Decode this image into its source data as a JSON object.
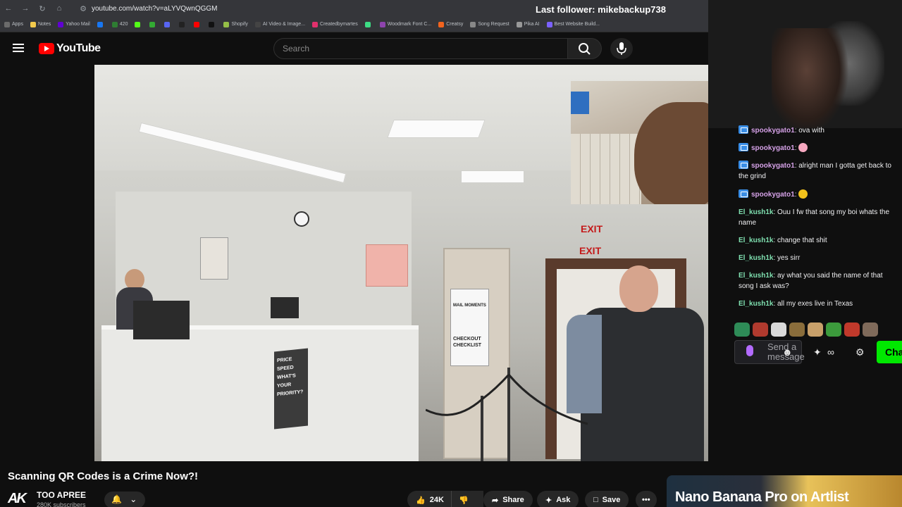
{
  "browser": {
    "url": "youtube.com/watch?v=aLYVQwnQGGM",
    "bookmarks": [
      {
        "label": "Apps",
        "color": "#6b6b6b"
      },
      {
        "label": "Notes",
        "color": "#f2c94c"
      },
      {
        "label": "Yahoo Mail",
        "color": "#6001d2"
      },
      {
        "label": "",
        "color": "#1877f2"
      },
      {
        "label": "420",
        "color": "#2e7d32"
      },
      {
        "label": "",
        "color": "#53fc18"
      },
      {
        "label": "",
        "color": "#33aa33"
      },
      {
        "label": "",
        "color": "#5865f2"
      },
      {
        "label": "",
        "color": "#222222"
      },
      {
        "label": "",
        "color": "#ff0000"
      },
      {
        "label": "",
        "color": "#111111"
      },
      {
        "label": "Shopify",
        "color": "#95bf47"
      },
      {
        "label": "AI Video & Image...",
        "color": "#444444"
      },
      {
        "label": "Createdbymartes",
        "color": "#e1306c"
      },
      {
        "label": "",
        "color": "#3ddc84"
      },
      {
        "label": "Woodmark Font C...",
        "color": "#8e44ad"
      },
      {
        "label": "Creatsy",
        "color": "#f1641e"
      },
      {
        "label": "Song Request",
        "color": "#888888"
      },
      {
        "label": "Pika AI",
        "color": "#999999"
      },
      {
        "label": "Best Website Build...",
        "color": "#7b61ff"
      }
    ]
  },
  "overlay": {
    "last_follower": "Last follower: mikebackup738"
  },
  "youtube": {
    "logo_text": "YouTube",
    "search_placeholder": "Search"
  },
  "video": {
    "exit_sign_1": "EXIT",
    "exit_sign_2": "EXIT",
    "checkout_sign": "CHECKOUT CHECKLIST",
    "mail_sign": "MAIL MOMENTS",
    "price_poster": "PRICE SPEED WHAT'S YOUR PRIORITY?"
  },
  "chat": {
    "messages": [
      {
        "user": "spookygato1",
        "text": "ova with",
        "emoji": null
      },
      {
        "user": "spookygato1",
        "text": "",
        "emoji": "pig-face"
      },
      {
        "user": "spookygato1",
        "text": "alright man I gotta get back to the grind",
        "emoji": null
      },
      {
        "user": "spookygato1",
        "text": "",
        "emoji": "star"
      },
      {
        "user": "El_kush1k",
        "text": "Ouu I fw that song my boi whats the name",
        "emoji": null
      },
      {
        "user": "El_kush1k",
        "text": "change that shit",
        "emoji": null
      },
      {
        "user": "El_kush1k",
        "text": "yes sirr",
        "emoji": null
      },
      {
        "user": "El_kush1k",
        "text": "ay what you said the name of that song I ask was?",
        "emoji": null
      },
      {
        "user": "El_kush1k",
        "text": "all my exes live in Texas",
        "emoji": null
      }
    ],
    "send_placeholder": "Send a message",
    "chat_button": "Cha",
    "accent": "#00e800",
    "emote_colors": [
      "#2e8b57",
      "#b03a2e",
      "#d9d9d9",
      "#8a6d3b",
      "#c8a06a",
      "#3c9a3c",
      "#c0392b",
      "#7f6a5a"
    ]
  },
  "below": {
    "title": "Scanning QR Codes is a Crime Now?!",
    "channel_logo": "AK",
    "channel_name": "TOO APREE",
    "subscribers": "280K subscribers",
    "likes": "24K",
    "share": "Share",
    "ask": "Ask",
    "save": "Save",
    "more": "•••",
    "ad_text": "Nano Banana Pro on Artlist"
  }
}
